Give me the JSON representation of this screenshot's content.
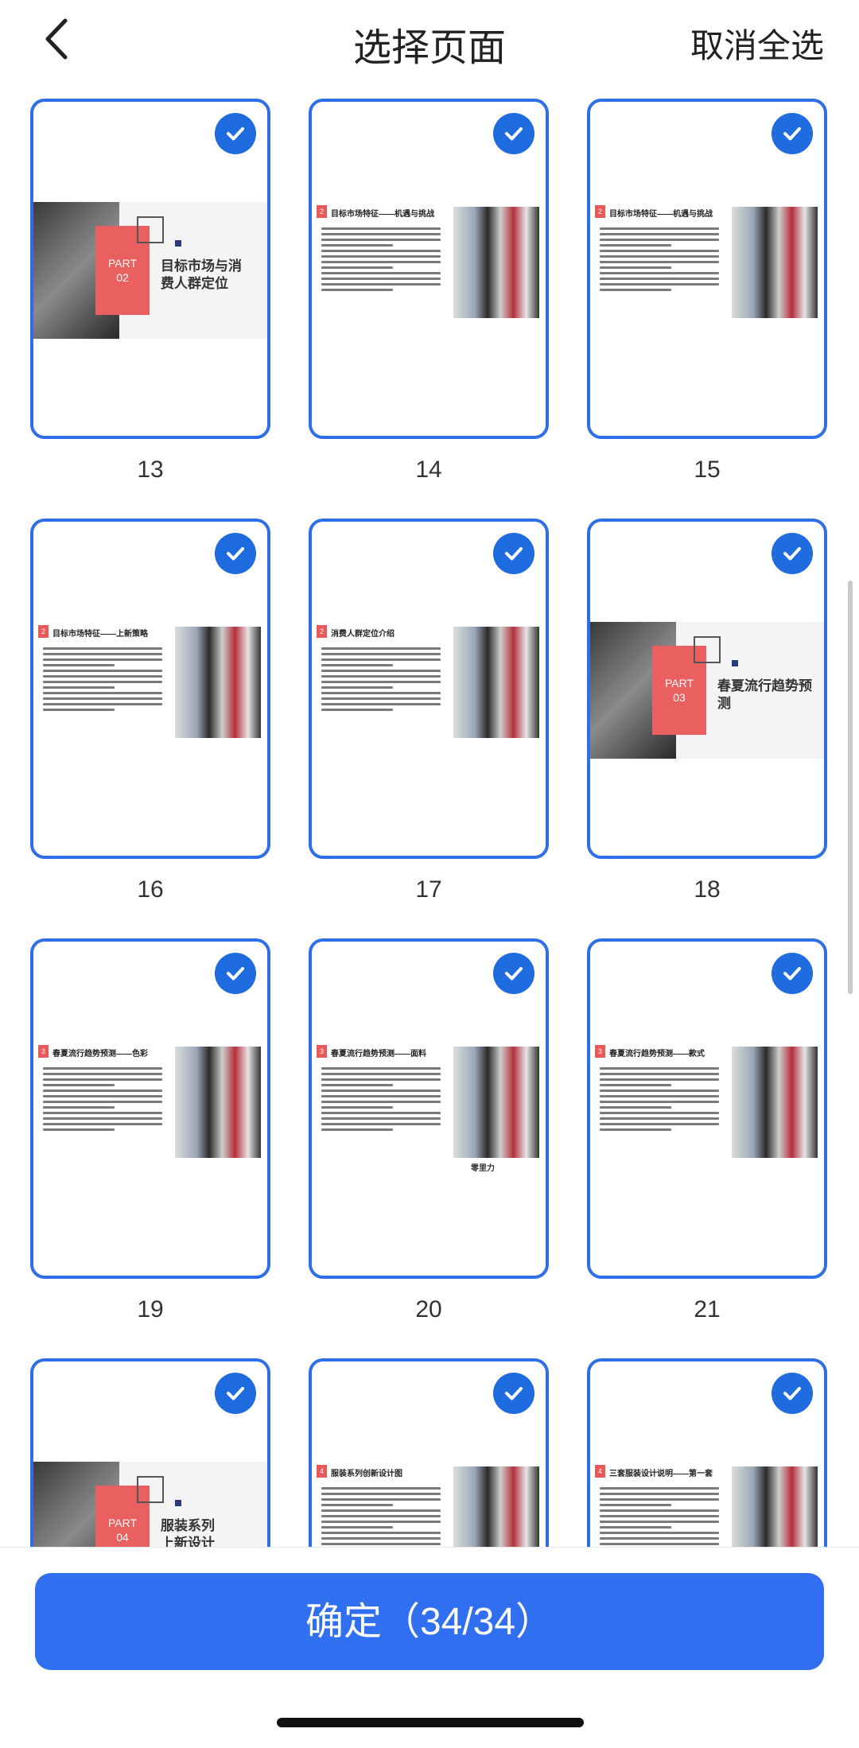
{
  "header": {
    "title": "选择页面",
    "deselect_all": "取消全选"
  },
  "pages": [
    {
      "number": "13",
      "kind": "section",
      "part": "PART",
      "part_no": "02",
      "heading": "目标市场与消费人群定位",
      "heading_l1": "目标市场与消",
      "heading_l2": "费人群定位"
    },
    {
      "number": "14",
      "kind": "content",
      "badge": "2",
      "heading": "目标市场特征——机遇与挑战"
    },
    {
      "number": "15",
      "kind": "content",
      "badge": "2",
      "heading": "目标市场特征——机遇与挑战"
    },
    {
      "number": "16",
      "kind": "content",
      "badge": "2",
      "heading": "目标市场特征——上新策略"
    },
    {
      "number": "17",
      "kind": "content",
      "badge": "2",
      "heading": "消费人群定位介绍"
    },
    {
      "number": "18",
      "kind": "section",
      "part": "PART",
      "part_no": "03",
      "heading_l1": "春夏流行趋势预",
      "heading_l2": "测"
    },
    {
      "number": "19",
      "kind": "content",
      "badge": "3",
      "heading": "春夏流行趋势预测——色彩"
    },
    {
      "number": "20",
      "kind": "content",
      "badge": "3",
      "heading": "春夏流行趋势预测——面料",
      "caption": "零里力"
    },
    {
      "number": "21",
      "kind": "content",
      "badge": "3",
      "heading": "春夏流行趋势预测——款式"
    },
    {
      "number": "",
      "kind": "section",
      "part": "PART",
      "part_no": "04",
      "heading_l1": "服装系列",
      "heading_l2": "上新设计"
    },
    {
      "number": "",
      "kind": "content",
      "badge": "4",
      "heading": "服装系列创新设计图"
    },
    {
      "number": "",
      "kind": "content",
      "badge": "4",
      "heading": "三套服装设计说明——第一套"
    }
  ],
  "selection": {
    "selected": 34,
    "total": 34
  },
  "footer": {
    "confirm_label": "确定（34/34）"
  },
  "colors": {
    "accent": "#2f6ff0",
    "card_border": "#2e6fe8",
    "slide_red": "#ea5f5f"
  }
}
